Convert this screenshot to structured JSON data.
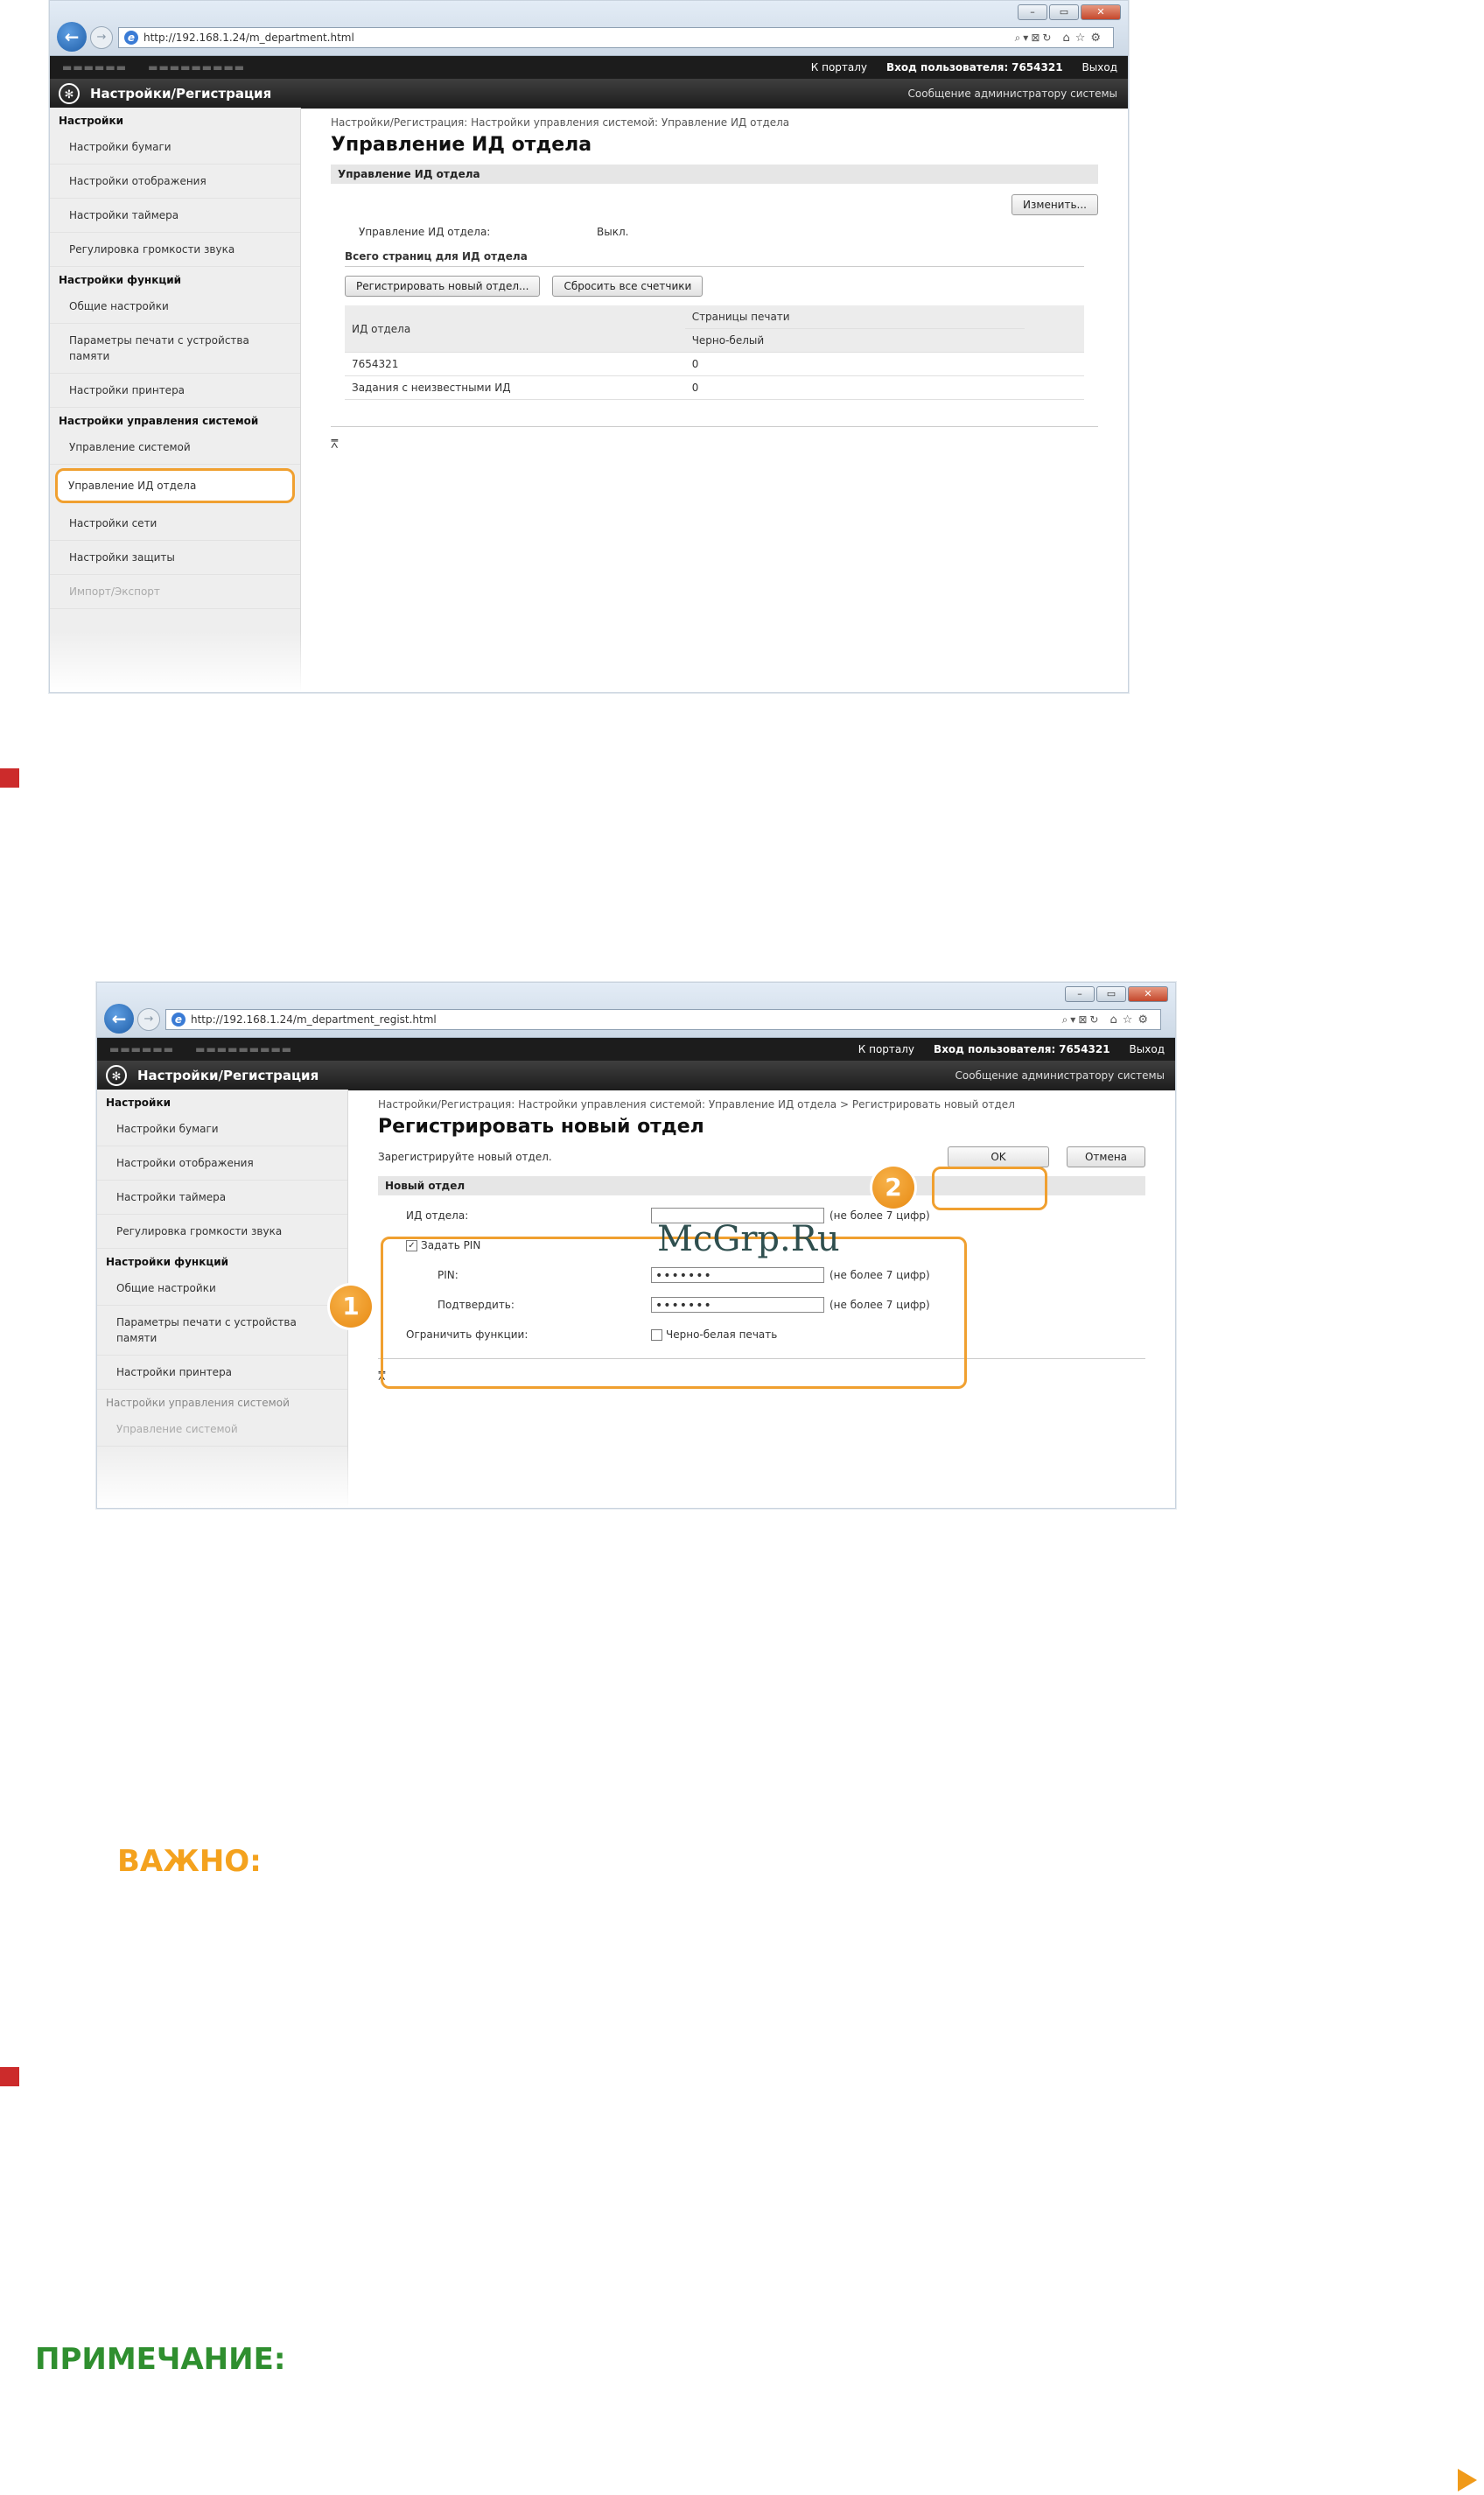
{
  "screen1": {
    "url": "http://192.168.1.24/m_department.html",
    "top_links": [
      "К порталу",
      "Вход пользователя:",
      "7654321",
      "Выход"
    ],
    "app_title": "Настройки/Регистрация",
    "admin_message": "Сообщение администратору системы",
    "sidebar": {
      "group1": "Настройки",
      "items1": [
        "Настройки бумаги",
        "Настройки отображения",
        "Настройки таймера",
        "Регулировка громкости звука"
      ],
      "group2": "Настройки функций",
      "items2": [
        "Общие настройки",
        "Параметры печати с устройства памяти",
        "Настройки принтера"
      ],
      "group3": "Настройки управления системой",
      "items3": [
        "Управление системой",
        "Управление ИД отдела",
        "Настройки сети",
        "Настройки защиты",
        "Импорт/Экспорт"
      ]
    },
    "breadcrumb": "Настройки/Регистрация: Настройки управления системой: Управление ИД отдела",
    "page_title": "Управление ИД отдела",
    "section_title": "Управление ИД отдела",
    "edit_button": "Изменить...",
    "status_label": "Управление ИД отдела:",
    "status_value": "Выкл.",
    "totals_title": "Всего страниц для ИД отдела",
    "register_button": "Регистрировать новый отдел...",
    "reset_button": "Сбросить все счетчики",
    "table": {
      "col_id": "ИД отдела",
      "col_pages": "Страницы печати",
      "col_bw": "Черно-белый",
      "rows": [
        {
          "id": "7654321",
          "bw": "0"
        },
        {
          "id": "Задания с неизвестными ИД",
          "bw": "0"
        }
      ]
    }
  },
  "screen2": {
    "url": "http://192.168.1.24/m_department_regist.html",
    "top_links": [
      "К порталу",
      "Вход пользователя:",
      "7654321",
      "Выход"
    ],
    "app_title": "Настройки/Регистрация",
    "admin_message": "Сообщение администратору системы",
    "sidebar": {
      "group1": "Настройки",
      "items1": [
        "Настройки бумаги",
        "Настройки отображения",
        "Настройки таймера",
        "Регулировка громкости звука"
      ],
      "group2": "Настройки функций",
      "items2": [
        "Общие настройки",
        "Параметры печати с устройства памяти",
        "Настройки принтера"
      ],
      "group3": "Настройки управления системой",
      "items3": [
        "Управление системой"
      ]
    },
    "breadcrumb": "Настройки/Регистрация: Настройки управления системой: Управление ИД отдела > Регистрировать новый отдел",
    "page_title": "Регистрировать новый отдел",
    "instruction": "Зарегистрируйте новый отдел.",
    "ok_button": "OK",
    "cancel_button": "Отмена",
    "section_title": "Новый отдел",
    "form": {
      "dept_id_label": "ИД отдела:",
      "dept_id_hint": "(не более 7 цифр)",
      "set_pin_label": "Задать PIN",
      "pin_label": "PIN:",
      "pin_value": "•••••••",
      "pin_hint": "(не более 7 цифр)",
      "confirm_label": "Подтвердить:",
      "confirm_value": "•••••••",
      "confirm_hint": "(не более 7 цифр)",
      "restrict_label": "Ограничить функции:",
      "restrict_option": "Черно-белая печать"
    },
    "callout1": "1",
    "callout2": "2",
    "watermark": "McGrp.Ru"
  },
  "headings": {
    "important": "ВАЖНО:",
    "note": "ПРИМЕЧАНИЕ:"
  },
  "colors": {
    "accent_orange": "#f0a030",
    "step_red": "#cc2b2b",
    "important_orange": "#f4a21e",
    "note_green": "#2f8f2f"
  }
}
